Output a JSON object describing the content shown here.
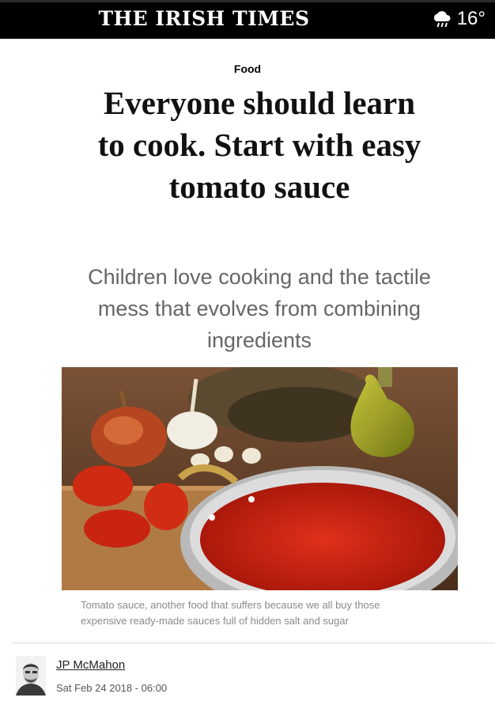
{
  "header": {
    "masthead": "THE IRISH TIMES",
    "weather_icon": "cloud-rain-icon",
    "temperature": "16°"
  },
  "article": {
    "section": "Food",
    "headline": "Everyone should learn to cook. Start with easy tomato sauce",
    "standfirst": "Children love cooking and the tactile mess that evolves from combining ingredients",
    "image_caption": "Tomato sauce, another food that suffers because we all buy those expensive ready-made sauces full of hidden salt and sugar",
    "author": "JP McMahon",
    "date": "Sat Feb 24 2018 - 06:00"
  },
  "colors": {
    "header_bg": "#000000",
    "headline": "#111111",
    "standfirst": "#666666",
    "caption": "#8a8a8a"
  }
}
